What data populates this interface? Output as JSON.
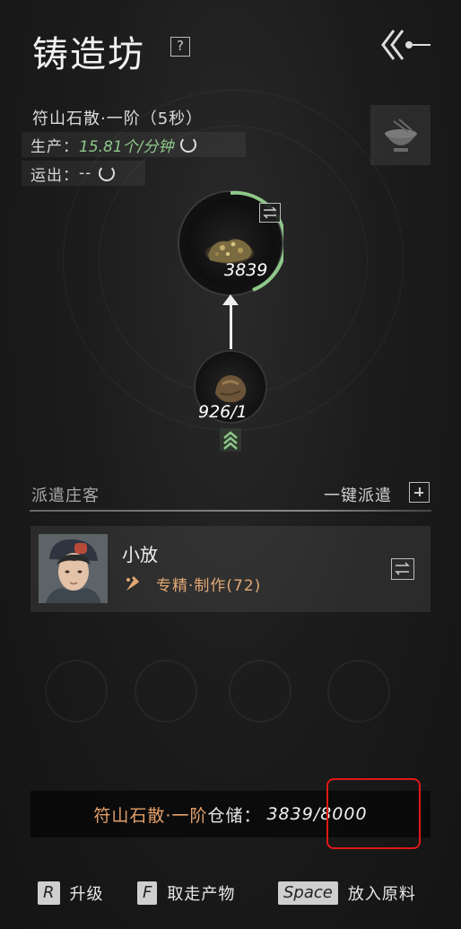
{
  "header": {
    "title": "铸造坊",
    "help_label": "?"
  },
  "recipe": {
    "name": "符山石散·一阶（5秒）",
    "production_label": "生产：",
    "production_rate": "15.81个/分钟",
    "shipping_label": "运出：",
    "shipping_value": "--"
  },
  "production_chain": {
    "output_count": "3839",
    "input_count": "926/1"
  },
  "dispatch": {
    "section_label": "派遣庄客",
    "dispatch_all_label": "一键派遣"
  },
  "worker": {
    "name": "小放",
    "skill": "专精·制作(72)"
  },
  "storage": {
    "item_name": "符山石散·一阶",
    "label": "仓储：",
    "value": "3839/8000"
  },
  "hotkeys": [
    {
      "key": "R",
      "label": "升级"
    },
    {
      "key": "F",
      "label": "取走产物"
    },
    {
      "key": "Space",
      "label": "放入原料"
    }
  ],
  "colors": {
    "accent_green": "#8ec88a",
    "accent_orange": "#e4a06a",
    "highlight_red": "#e11818"
  }
}
